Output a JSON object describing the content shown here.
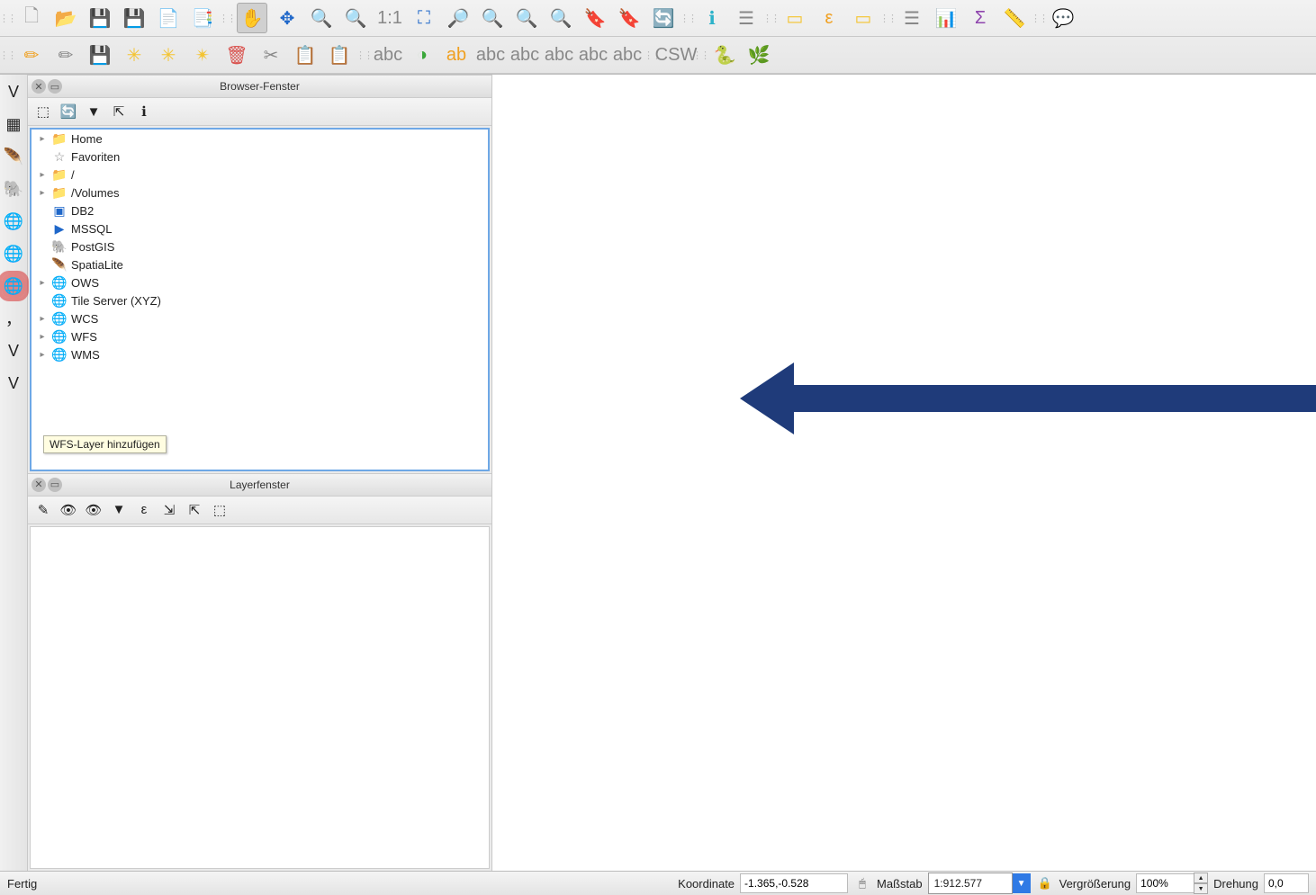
{
  "toolbars": {
    "row1": [
      {
        "name": "new-project",
        "glyph": "🗋",
        "cls": "ic-file"
      },
      {
        "name": "open-project",
        "glyph": "📂",
        "cls": "ic-folder"
      },
      {
        "name": "save-project",
        "glyph": "💾",
        "cls": "ic-save"
      },
      {
        "name": "save-project-as",
        "glyph": "💾",
        "cls": "ic-save"
      },
      {
        "name": "new-print-composer",
        "glyph": "📄",
        "cls": "ic-gray"
      },
      {
        "name": "composer-manager",
        "glyph": "📑",
        "cls": "ic-gray"
      },
      {
        "grip": true
      },
      {
        "name": "pan-map",
        "glyph": "✋",
        "cls": "ic-orange",
        "active": true
      },
      {
        "name": "pan-to-selection",
        "glyph": "✥",
        "cls": "ic-blue"
      },
      {
        "name": "zoom-in",
        "glyph": "🔍",
        "cls": "ic-blue"
      },
      {
        "name": "zoom-out",
        "glyph": "🔍",
        "cls": "ic-blue"
      },
      {
        "name": "zoom-native",
        "glyph": "1:1",
        "cls": "ic-gray"
      },
      {
        "name": "zoom-full",
        "glyph": "⛶",
        "cls": "ic-blue"
      },
      {
        "name": "zoom-selection",
        "glyph": "🔎",
        "cls": "ic-yellow"
      },
      {
        "name": "zoom-layer",
        "glyph": "🔍",
        "cls": "ic-gray"
      },
      {
        "name": "zoom-last",
        "glyph": "🔍",
        "cls": "ic-gray"
      },
      {
        "name": "zoom-next",
        "glyph": "🔍",
        "cls": "ic-gray"
      },
      {
        "name": "new-bookmark",
        "glyph": "🔖",
        "cls": "ic-gray"
      },
      {
        "name": "show-bookmarks",
        "glyph": "🔖",
        "cls": "ic-gray"
      },
      {
        "name": "refresh",
        "glyph": "🔄",
        "cls": "ic-blue"
      },
      {
        "grip": true
      },
      {
        "name": "identify",
        "glyph": "ℹ",
        "cls": "ic-cyan"
      },
      {
        "name": "open-attribute-table",
        "glyph": "☰",
        "cls": "ic-gray"
      },
      {
        "grip": true
      },
      {
        "name": "select-features",
        "glyph": "▭",
        "cls": "ic-yellow"
      },
      {
        "name": "select-by-expression",
        "glyph": "ε",
        "cls": "ic-orange"
      },
      {
        "name": "deselect-all",
        "glyph": "▭",
        "cls": "ic-yellow"
      },
      {
        "grip": true
      },
      {
        "name": "open-field-calc",
        "glyph": "☰",
        "cls": "ic-gray"
      },
      {
        "name": "statistics",
        "glyph": "📊",
        "cls": "ic-gray"
      },
      {
        "name": "sum",
        "glyph": "Σ",
        "cls": "ic-purple"
      },
      {
        "name": "measure",
        "glyph": "📏",
        "cls": "ic-gray"
      },
      {
        "grip": true
      },
      {
        "name": "map-tips",
        "glyph": "💬",
        "cls": "ic-yellow"
      }
    ],
    "row2": [
      {
        "grip": true
      },
      {
        "name": "current-edits",
        "glyph": "✏",
        "cls": "ic-orange"
      },
      {
        "name": "toggle-editing",
        "glyph": "✏",
        "cls": "ic-gray"
      },
      {
        "name": "save-layer-edits",
        "glyph": "💾",
        "cls": "ic-save"
      },
      {
        "name": "add-feature",
        "glyph": "✳",
        "cls": "ic-yellow"
      },
      {
        "name": "move-feature",
        "glyph": "✳",
        "cls": "ic-yellow"
      },
      {
        "name": "node-tool",
        "glyph": "✴",
        "cls": "ic-yellow"
      },
      {
        "name": "delete-selected",
        "glyph": "🗑",
        "cls": "ic-red"
      },
      {
        "name": "cut-features",
        "glyph": "✂",
        "cls": "ic-gray"
      },
      {
        "name": "copy-features",
        "glyph": "📋",
        "cls": "ic-gray"
      },
      {
        "name": "paste-features",
        "glyph": "📋",
        "cls": "ic-gray"
      },
      {
        "grip": true
      },
      {
        "name": "label-tool-1",
        "glyph": "abc",
        "cls": "ic-gray"
      },
      {
        "name": "style-manager",
        "glyph": "◑",
        "cls": "ic-green"
      },
      {
        "name": "label-tool-2",
        "glyph": "ab",
        "cls": "ic-orange"
      },
      {
        "name": "label-tool-3",
        "glyph": "abc",
        "cls": "ic-gray"
      },
      {
        "name": "label-tool-4",
        "glyph": "abc",
        "cls": "ic-gray"
      },
      {
        "name": "label-tool-5",
        "glyph": "abc",
        "cls": "ic-gray"
      },
      {
        "name": "label-tool-6",
        "glyph": "abc",
        "cls": "ic-gray"
      },
      {
        "name": "label-tool-7",
        "glyph": "abc",
        "cls": "ic-gray"
      },
      {
        "grip": true
      },
      {
        "name": "metasearch",
        "glyph": "CSW",
        "cls": "ic-gray"
      },
      {
        "grip": true
      },
      {
        "name": "python-console",
        "glyph": "🐍",
        "cls": ""
      },
      {
        "name": "plugin",
        "glyph": "🌿",
        "cls": "ic-green"
      }
    ]
  },
  "sideToolbar": [
    {
      "name": "add-vector-layer",
      "glyph": "V"
    },
    {
      "name": "add-raster-layer",
      "glyph": "▦"
    },
    {
      "name": "add-spatialite-layer",
      "glyph": "🪶"
    },
    {
      "name": "add-postgis-layer",
      "glyph": "🐘"
    },
    {
      "name": "add-wms-layer",
      "glyph": "🌐"
    },
    {
      "name": "add-wcs-layer",
      "glyph": "🌐"
    },
    {
      "name": "add-wfs-layer",
      "glyph": "🌐",
      "highlight": true
    },
    {
      "name": "add-delimited-text",
      "glyph": "，"
    },
    {
      "name": "add-virtual-layer",
      "glyph": "V"
    },
    {
      "name": "new-shapefile",
      "glyph": "V"
    }
  ],
  "browserPanel": {
    "title": "Browser-Fenster",
    "toolbar": [
      {
        "name": "add-layer",
        "glyph": "⬚"
      },
      {
        "name": "refresh",
        "glyph": "🔄"
      },
      {
        "name": "filter",
        "glyph": "▼"
      },
      {
        "name": "collapse-all",
        "glyph": "⇱"
      },
      {
        "name": "properties",
        "glyph": "ℹ"
      }
    ],
    "tree": [
      {
        "expand": true,
        "icon": "📁",
        "label": "Home",
        "cls": "ic-blue"
      },
      {
        "expand": false,
        "icon": "☆",
        "label": "Favoriten",
        "cls": "ic-gray"
      },
      {
        "expand": true,
        "icon": "📁",
        "label": "/",
        "cls": "ic-blue"
      },
      {
        "expand": true,
        "icon": "📁",
        "label": "/Volumes",
        "cls": "ic-blue"
      },
      {
        "expand": false,
        "icon": "▣",
        "label": "DB2",
        "cls": "ic-blue"
      },
      {
        "expand": false,
        "icon": "▶",
        "label": "MSSQL",
        "cls": "ic-blue"
      },
      {
        "expand": false,
        "icon": "🐘",
        "label": "PostGIS",
        "cls": "ic-gray"
      },
      {
        "expand": false,
        "icon": "🪶",
        "label": "SpatiaLite",
        "cls": "ic-blue"
      },
      {
        "expand": true,
        "icon": "🌐",
        "label": "OWS",
        "cls": "ic-blue"
      },
      {
        "expand": false,
        "icon": "🌐",
        "label": "Tile Server (XYZ)",
        "cls": "ic-blue"
      },
      {
        "expand": true,
        "icon": "🌐",
        "label": "WCS",
        "cls": "ic-blue"
      },
      {
        "expand": true,
        "icon": "🌐",
        "label": "WFS",
        "cls": "ic-blue"
      },
      {
        "expand": true,
        "icon": "🌐",
        "label": "WMS",
        "cls": "ic-blue"
      }
    ]
  },
  "layerPanel": {
    "title": "Layerfenster",
    "toolbar": [
      {
        "name": "style-preset",
        "glyph": "✎"
      },
      {
        "name": "manage-visibility",
        "glyph": "👁"
      },
      {
        "name": "filter-legend",
        "glyph": "👁"
      },
      {
        "name": "filter",
        "glyph": "▼"
      },
      {
        "name": "expression",
        "glyph": "ε"
      },
      {
        "name": "expand-all",
        "glyph": "⇲"
      },
      {
        "name": "collapse-all",
        "glyph": "⇱"
      },
      {
        "name": "remove",
        "glyph": "⬚"
      }
    ]
  },
  "tooltip": {
    "text": "WFS-Layer hinzufügen"
  },
  "status": {
    "ready": "Fertig",
    "coord_label": "Koordinate",
    "coord_value": "-1.365,-0.528",
    "scale_label": "Maßstab",
    "scale_value": "1:912.577",
    "magnify_label": "Vergrößerung",
    "magnify_value": "100%",
    "rotation_label": "Drehung",
    "rotation_value": "0,0"
  }
}
